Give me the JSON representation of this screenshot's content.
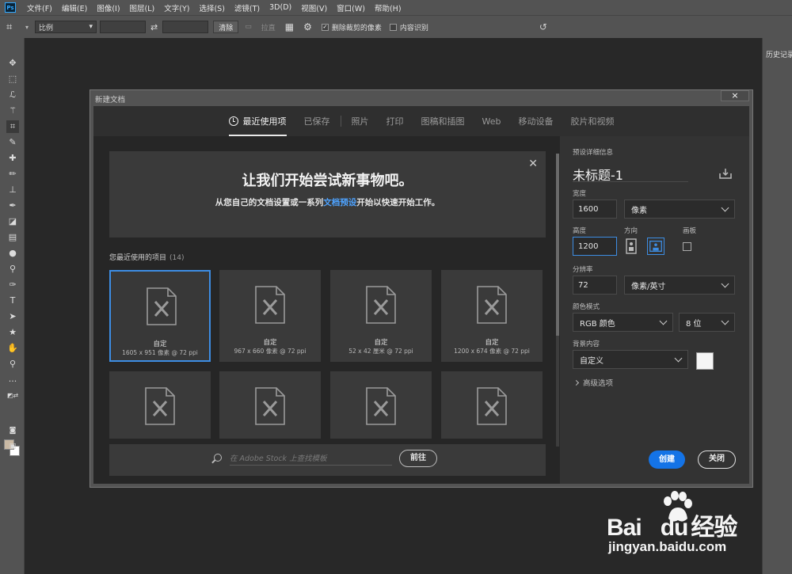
{
  "app": {
    "logo": "Ps"
  },
  "menu": [
    "文件(F)",
    "编辑(E)",
    "图像(I)",
    "图层(L)",
    "文字(Y)",
    "选择(S)",
    "滤镜(T)",
    "3D(D)",
    "视图(V)",
    "窗口(W)",
    "帮助(H)"
  ],
  "options": {
    "ratio_select": "比例",
    "clear_label": "清除",
    "straighten_label": "拉直",
    "delete_cropped_label": "删除裁剪的像素",
    "delete_cropped_checked": true,
    "content_aware_label": "内容识别",
    "content_aware_checked": false
  },
  "right_panel": {
    "tab": "历史记录"
  },
  "dialog": {
    "title": "新建文档",
    "close_symbol": "×",
    "tabs": [
      {
        "label": "最近使用项",
        "active": true
      },
      {
        "label": "已保存"
      },
      {
        "label": "照片"
      },
      {
        "label": "打印"
      },
      {
        "label": "图稿和插图"
      },
      {
        "label": "Web"
      },
      {
        "label": "移动设备"
      },
      {
        "label": "胶片和视频"
      }
    ],
    "banner": {
      "title": "让我们开始尝试新事物吧。",
      "sub_before": "从您自己的文档设置或一系列",
      "sub_link": "文档预设",
      "sub_after": "开始以快速开始工作。",
      "close_symbol": "✕"
    },
    "recent": {
      "label": "您最近使用的项目",
      "count": "(14)",
      "items": [
        {
          "name": "自定",
          "desc": "1605 x 951 像素 @ 72 ppi",
          "selected": true
        },
        {
          "name": "自定",
          "desc": "967 x 660 像素 @ 72 ppi"
        },
        {
          "name": "自定",
          "desc": "52 x 42 厘米 @ 72 ppi"
        },
        {
          "name": "自定",
          "desc": "1200 x 674 像素 @ 72 ppi"
        },
        {
          "name": "",
          "desc": ""
        },
        {
          "name": "",
          "desc": ""
        },
        {
          "name": "",
          "desc": ""
        },
        {
          "name": "",
          "desc": ""
        }
      ]
    },
    "stock": {
      "placeholder": "在 Adobe Stock 上查找模板",
      "button": "前往"
    },
    "details": {
      "section_label": "预设详细信息",
      "doc_title": "未标题-1",
      "width_label": "宽度",
      "width_value": "1600",
      "width_unit": "像素",
      "height_label": "高度",
      "height_value": "1200",
      "orientation_label": "方向",
      "artboard_label": "画板",
      "resolution_label": "分辨率",
      "resolution_value": "72",
      "resolution_unit": "像素/英寸",
      "color_mode_label": "颜色模式",
      "color_mode_value": "RGB 颜色",
      "bit_depth_value": "8 位",
      "background_label": "背景内容",
      "background_value": "自定义",
      "background_color": "#f5f5f5",
      "advanced_label": "高级选项",
      "create_label": "创建",
      "close_label": "关闭"
    }
  },
  "watermark": {
    "brand": "Bai",
    "brand_du": "du",
    "cn": "经验",
    "url": "jingyan.baidu.com"
  },
  "colors": {
    "accent": "#1473e6",
    "link": "#4ea3ff",
    "selection": "#3d8de3",
    "foreground_swatch": "#c9b9a4",
    "background_swatch": "#ffffff"
  }
}
